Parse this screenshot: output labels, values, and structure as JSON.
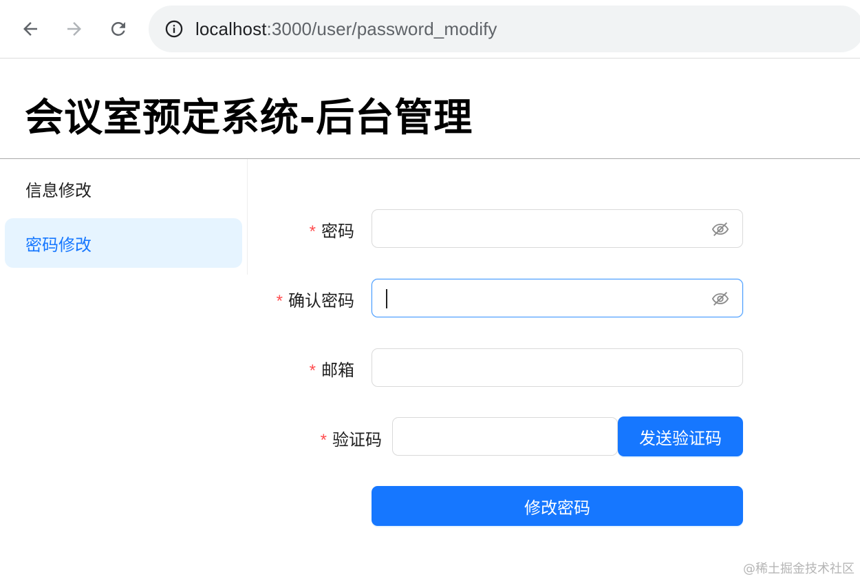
{
  "browser": {
    "url_host": "localhost",
    "url_rest": ":3000/user/password_modify"
  },
  "page": {
    "title": "会议室预定系统-后台管理"
  },
  "sidebar": {
    "items": [
      {
        "label": "信息修改",
        "active": false
      },
      {
        "label": "密码修改",
        "active": true
      }
    ]
  },
  "form": {
    "required_mark": "*",
    "password": {
      "label": "密码",
      "value": ""
    },
    "confirm_password": {
      "label": "确认密码",
      "value": ""
    },
    "email": {
      "label": "邮箱",
      "value": ""
    },
    "captcha": {
      "label": "验证码",
      "value": "",
      "send_button": "发送验证码"
    },
    "submit_button": "修改密码"
  },
  "watermark": "@稀土掘金技术社区",
  "colors": {
    "primary": "#1677ff",
    "active_menu_bg": "#e6f4ff",
    "required": "#ff4d4f"
  }
}
